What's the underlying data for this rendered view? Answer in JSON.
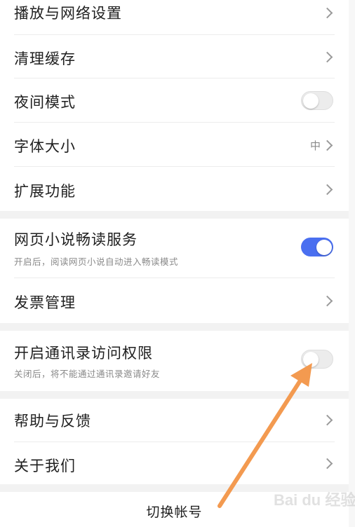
{
  "settings": {
    "items": [
      {
        "label": "播放与网络设置"
      },
      {
        "label": "清理缓存"
      },
      {
        "label": "夜间模式",
        "toggle": "off"
      },
      {
        "label": "字体大小",
        "value": "中"
      },
      {
        "label": "扩展功能"
      },
      {
        "label": "网页小说畅读服务",
        "sub": "开启后，阅读网页小说自动进入畅读模式",
        "toggle": "on"
      },
      {
        "label": "发票管理"
      },
      {
        "label": "开启通讯录访问权限",
        "sub": "关闭后，将不能通过通讯录邀请好友",
        "toggle": "off"
      },
      {
        "label": "帮助与反馈"
      },
      {
        "label": "关于我们"
      }
    ],
    "switch_account": "切换帐号"
  },
  "annotation": {
    "arrow_color": "#f39a50"
  },
  "watermark": {
    "text": "Bai du 经验"
  },
  "colors": {
    "accent": "#4a6ff0",
    "section_gap": "#f2f2f2"
  }
}
